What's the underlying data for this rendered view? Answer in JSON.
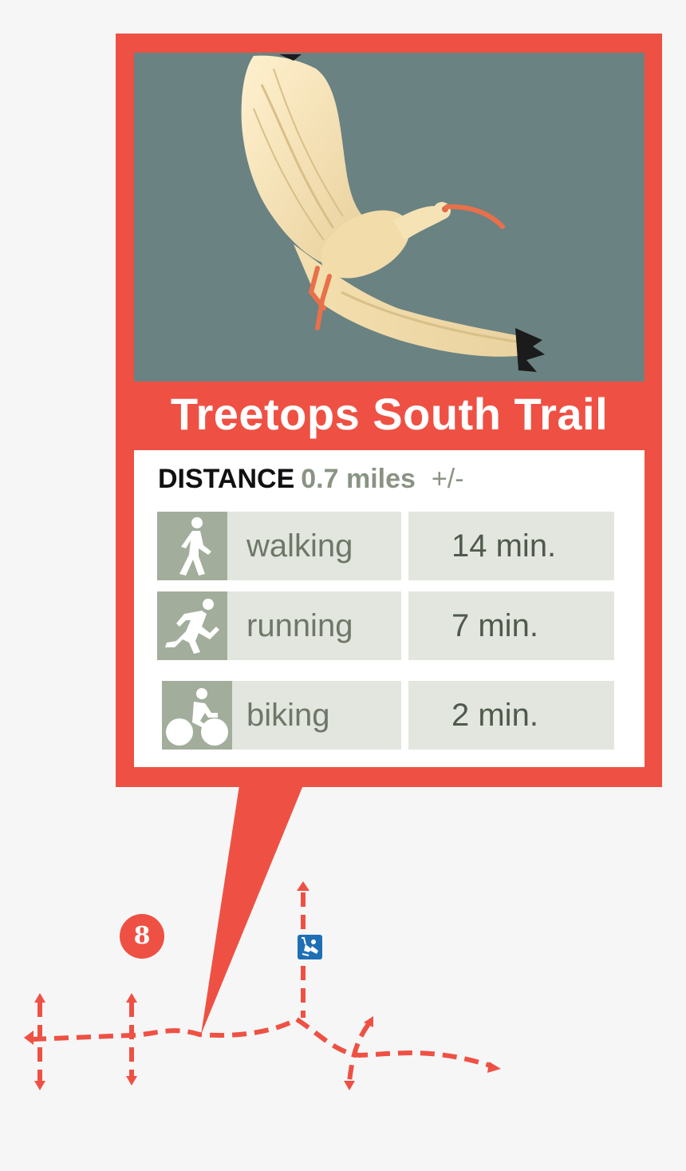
{
  "trail": {
    "name": "Treetops South Trail",
    "photo_subject": "white ibis",
    "distance": {
      "label": "DISTANCE",
      "value": "0.7 miles",
      "suffix": "+/-"
    },
    "modes": [
      {
        "icon": "walking-person-icon",
        "label": "walking",
        "time": "14 min."
      },
      {
        "icon": "running-person-icon",
        "label": "running",
        "time": "7 min."
      },
      {
        "icon": "bicycle-rider-icon",
        "label": "biking",
        "time": "2 min."
      }
    ]
  },
  "map": {
    "marker_number": "8",
    "amenity_icon": "playground-swing-icon"
  },
  "colors": {
    "accent": "#ee5144",
    "photo_sky": "#6a8282",
    "icon_tile": "#a2ad9b",
    "cell_bg": "#e2e6df",
    "sign_blue": "#1f6fb5"
  }
}
